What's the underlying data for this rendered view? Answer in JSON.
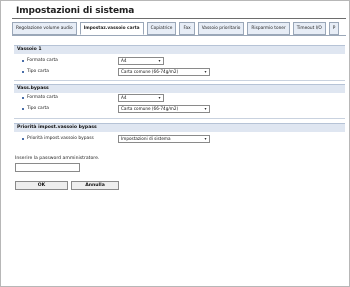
{
  "page": {
    "title": "Impostazioni di sistema"
  },
  "tabs": [
    {
      "label": "Regolazione volume audio"
    },
    {
      "label": "Impostaz.vassoio carta"
    },
    {
      "label": "Copiatrice"
    },
    {
      "label": "Fax"
    },
    {
      "label": "Vassoio prioritario"
    },
    {
      "label": "Risparmio toner"
    },
    {
      "label": "Timeout I/O"
    },
    {
      "label": "P"
    }
  ],
  "sections": {
    "tray1": {
      "title": "Vassoio 1",
      "paper_size_label": "Formato carta",
      "paper_size_value": "A4",
      "paper_type_label": "Tipo carta",
      "paper_type_value": "Carta comune (66-74g/m2)"
    },
    "bypass": {
      "title": "Vass.bypass",
      "paper_size_label": "Formato carta",
      "paper_size_value": "A4",
      "paper_type_label": "Tipo carta",
      "paper_type_value": "Carta comune (66-74g/m2)"
    },
    "priority": {
      "title": "Priorità impost.vassoio bypass",
      "setting_label": "Priorità impost.vassoio bypass",
      "setting_value": "Impostazioni di sistema"
    }
  },
  "password": {
    "label": "Inserire la password amministratore.",
    "value": ""
  },
  "buttons": {
    "ok": "OK",
    "cancel": "Annulla"
  },
  "icons": {
    "dropdown": "chevron-down-icon"
  }
}
